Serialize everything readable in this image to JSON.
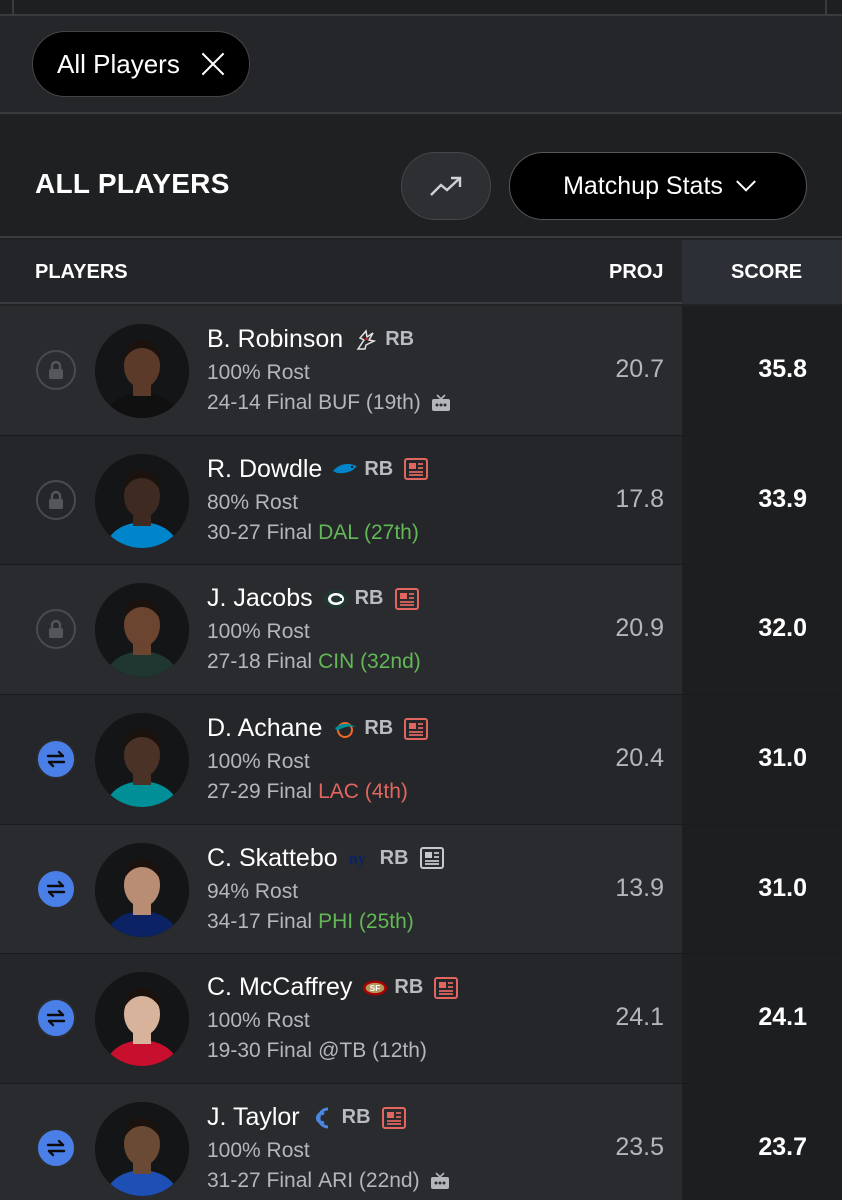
{
  "filter_chip": {
    "label": "All Players"
  },
  "header": {
    "title": "ALL PLAYERS",
    "stats_dropdown": "Matchup Stats"
  },
  "columns": {
    "players": "PLAYERS",
    "proj": "PROJ",
    "score": "SCORE"
  },
  "colors": {
    "score_col_bg": "#1d1e20",
    "green": "#62b856",
    "red": "#e0665f",
    "swap_blue": "#4a7fe8"
  },
  "players": [
    {
      "name": "B. Robinson",
      "team_icon": "falcons-logo-icon",
      "pos": "RB",
      "news": false,
      "rost": "100% Rost",
      "game": "24-14 Final",
      "opp": "BUF (19th)",
      "opp_color": "grey",
      "tv": true,
      "proj": "20.7",
      "score": "35.8",
      "action": "lock"
    },
    {
      "name": "R. Dowdle",
      "team_icon": "panthers-logo-icon",
      "pos": "RB",
      "news": true,
      "rost": "80% Rost",
      "game": "30-27 Final",
      "opp": "DAL (27th)",
      "opp_color": "green",
      "tv": false,
      "proj": "17.8",
      "score": "33.9",
      "action": "lock"
    },
    {
      "name": "J. Jacobs",
      "team_icon": "packers-logo-icon",
      "pos": "RB",
      "news": true,
      "rost": "100% Rost",
      "game": "27-18 Final",
      "opp": "CIN (32nd)",
      "opp_color": "green",
      "tv": false,
      "proj": "20.9",
      "score": "32.0",
      "action": "lock"
    },
    {
      "name": "D. Achane",
      "team_icon": "dolphins-logo-icon",
      "pos": "RB",
      "news": true,
      "rost": "100% Rost",
      "game": "27-29 Final",
      "opp": "LAC (4th)",
      "opp_color": "red",
      "tv": false,
      "proj": "20.4",
      "score": "31.0",
      "action": "swap"
    },
    {
      "name": "C. Skattebo",
      "team_icon": "giants-logo-icon",
      "pos": "RB",
      "news": true,
      "rost": "94% Rost",
      "game": "34-17 Final",
      "opp": "PHI (25th)",
      "opp_color": "green",
      "tv": false,
      "proj": "13.9",
      "score": "31.0",
      "action": "swap"
    },
    {
      "name": "C. McCaffrey",
      "team_icon": "49ers-logo-icon",
      "pos": "RB",
      "news": true,
      "rost": "100% Rost",
      "game": "19-30 Final",
      "opp": "@TB (12th)",
      "opp_color": "grey",
      "tv": false,
      "proj": "24.1",
      "score": "24.1",
      "action": "swap"
    },
    {
      "name": "J. Taylor",
      "team_icon": "colts-logo-icon",
      "pos": "RB",
      "news": true,
      "rost": "100% Rost",
      "game": "31-27 Final",
      "opp": "ARI (22nd)",
      "opp_color": "grey",
      "tv": true,
      "proj": "23.5",
      "score": "23.7",
      "action": "swap"
    }
  ]
}
